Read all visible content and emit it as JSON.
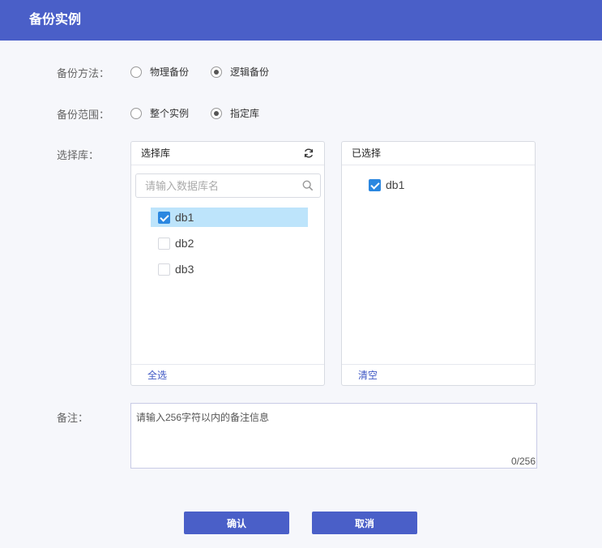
{
  "dialog": {
    "title": "备份实例"
  },
  "backup_method": {
    "label": "备份方法：",
    "options": [
      {
        "label": "物理备份",
        "checked": false
      },
      {
        "label": "逻辑备份",
        "checked": true
      }
    ]
  },
  "backup_scope": {
    "label": "备份范围：",
    "options": [
      {
        "label": "整个实例",
        "checked": false
      },
      {
        "label": "指定库",
        "checked": true
      }
    ]
  },
  "select_db": {
    "label": "选择库：",
    "source": {
      "title": "选择库",
      "search_placeholder": "请输入数据库名",
      "items": [
        {
          "name": "db1",
          "checked": true
        },
        {
          "name": "db2",
          "checked": false
        },
        {
          "name": "db3",
          "checked": false
        }
      ],
      "footer": "全选"
    },
    "target": {
      "title": "已选择",
      "items": [
        {
          "name": "db1",
          "checked": true
        }
      ],
      "footer": "清空"
    }
  },
  "remark": {
    "label": "备注：",
    "placeholder": "请输入256字符以内的备注信息",
    "counter": "0/256"
  },
  "actions": {
    "confirm": "确认",
    "cancel": "取消"
  },
  "colors": {
    "primary": "#4a5fc8",
    "checkbox": "#2b87e0",
    "selected_row": "#bde4fb",
    "link": "#3d56c4"
  }
}
